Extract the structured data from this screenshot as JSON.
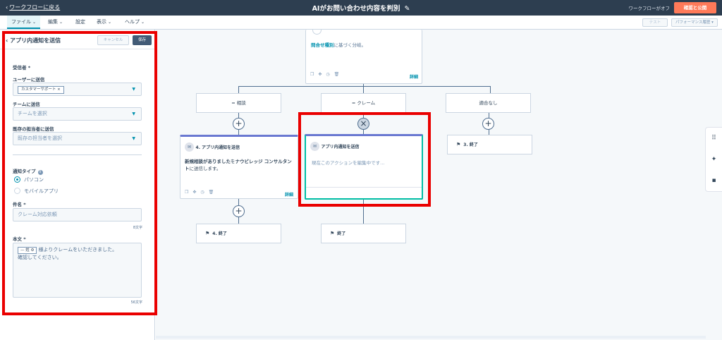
{
  "topbar": {
    "back_label": "ワークフローに戻る",
    "title": "AIがお問い合わせ内容を判別",
    "status": "ワークフローがオフ",
    "publish_label": "確認と公開"
  },
  "menubar": {
    "items": [
      "ファイル",
      "編集",
      "設定",
      "表示",
      "ヘルプ"
    ],
    "test_label": "テスト",
    "perf_label": "パフォーマンス履歴"
  },
  "panel": {
    "title": "アプリ内通知を送信",
    "cancel_label": "キャンセル",
    "save_label": "保存",
    "recipients_label": "受信者 *",
    "users_label": "ユーザーに送信",
    "users_tag": "カスタマーサポート",
    "team_label": "チームに送信",
    "team_placeholder": "チームを選択",
    "owner_label": "既存の担当者に送信",
    "owner_placeholder": "既存の担当者を選択",
    "notif_type_label": "通知タイプ",
    "radio_pc": "パソコン",
    "radio_mobile": "モバイルアプリ",
    "subject_label": "件名 *",
    "subject_value": "クレーム対応依頼",
    "subject_count": "8文字",
    "body_label": "本文 *",
    "body_token": "— 姓",
    "body_text1": "様よりクレームをいただきました。",
    "body_text2": "確認してください。",
    "body_count": "56文字"
  },
  "canvas": {
    "top_card_link": "問合せ種別",
    "top_card_text": "に基づく分岐。",
    "detail_label": "詳細",
    "branch_1": "= 相談",
    "branch_2": "= クレーム",
    "branch_3": "適合なし",
    "action4_title": "4. アプリ内通知を送信",
    "action4_bold": "新規相談がありました",
    "action4_mid": "を",
    "action4_bold2": "ナウビレッジ コンサルタント",
    "action4_end": "に送信します。",
    "editing_title": "アプリ内通知を送信",
    "editing_text": "現在このアクションを編集中です...",
    "end_3": "3. 終了",
    "end_4": "4. 終了",
    "end_new": "終了"
  },
  "colors": {
    "topbar": "#2d3e50",
    "accent": "#ff7a59",
    "teal": "#0091ae",
    "highlight_red": "#ea0000"
  }
}
